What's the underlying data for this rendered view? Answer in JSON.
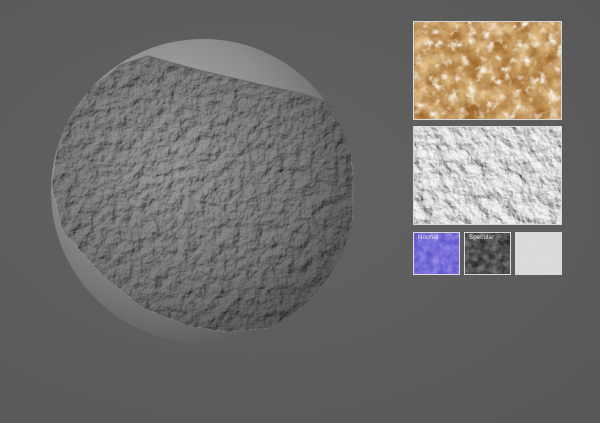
{
  "viewport": {
    "background": "#5e5e5e"
  },
  "preview_sphere": {
    "icon": "displaced-sphere-preview",
    "base_color": "#9a9a9a"
  },
  "texture_maps": {
    "albedo": {
      "label": "",
      "dominant_color": "#c08a3c"
    },
    "height": {
      "label": "",
      "dominant_color": "#c9c9c9"
    },
    "normal": {
      "label": "Normal",
      "dominant_color": "#6b64d6"
    },
    "specular": {
      "label": "Specular",
      "dominant_color": "#3a3a3a"
    },
    "roughness": {
      "label": "",
      "dominant_color": "#d8d8d8"
    }
  }
}
